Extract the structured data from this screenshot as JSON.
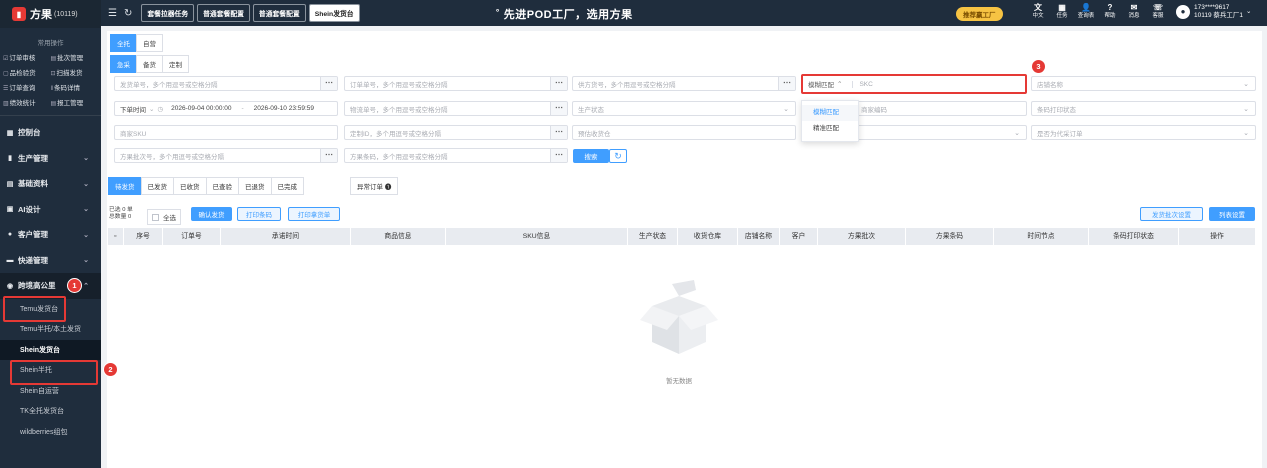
{
  "app": {
    "name": "方果",
    "account_id": "(10119)"
  },
  "sidebar": {
    "quick_title": "常用操作",
    "quick_ops": [
      {
        "icon": "check-icon",
        "label": "订单审核"
      },
      {
        "icon": "batch-icon",
        "label": "批次管理"
      },
      {
        "icon": "inspect-icon",
        "label": "品检验货"
      },
      {
        "icon": "scan-icon",
        "label": "扫描发货"
      },
      {
        "icon": "order-query-icon",
        "label": "订单查询"
      },
      {
        "icon": "barcode-icon",
        "label": "条码详情"
      },
      {
        "icon": "stats-icon",
        "label": "绩效统计"
      },
      {
        "icon": "report-icon",
        "label": "报工管理"
      }
    ],
    "menu": [
      {
        "label": "控制台",
        "icon": "dashboard-icon"
      },
      {
        "label": "生产管理",
        "icon": "production-icon"
      },
      {
        "label": "基础资料",
        "icon": "database-icon"
      },
      {
        "label": "AI设计",
        "icon": "ai-icon"
      },
      {
        "label": "客户管理",
        "icon": "customer-icon"
      },
      {
        "label": "快递管理",
        "icon": "express-icon"
      },
      {
        "label": "跨境高公里",
        "icon": "crossborder-icon"
      }
    ],
    "submenu": [
      "Temu发货台",
      "Temu半托/本土发货",
      "Shein发货台",
      "Shein半托",
      "Shein自运营",
      "TK全托发货台",
      "wildberries组包"
    ]
  },
  "topbar": {
    "tabs": [
      "套餐拉器任务",
      "普通套餐配置",
      "普通套餐配置",
      "Shein发货台"
    ],
    "slogan": "先进POD工厂，选用方果",
    "promo": "推荐赢工厂",
    "tools": [
      {
        "label": "中文",
        "icon": "translate-icon"
      },
      {
        "label": "任务",
        "icon": "task-icon"
      },
      {
        "label": "查询表",
        "icon": "query-icon"
      },
      {
        "label": "帮助",
        "icon": "help-icon"
      },
      {
        "label": "消息",
        "icon": "message-icon"
      },
      {
        "label": "客服",
        "icon": "service-icon"
      }
    ],
    "user": {
      "phone": "173****9617",
      "name": "10119 蔡兵工厂1"
    }
  },
  "filters": {
    "scope_tabs": [
      "全托",
      "自营"
    ],
    "type_tabs": [
      "急采",
      "备货",
      "定制"
    ],
    "placeholders": {
      "ship_no": "发货单号，多个用逗号或空格分隔",
      "order_no": "订单单号，多个用逗号或空格分隔",
      "supplier_no": "供方货号，多个用逗号或空格分隔",
      "skc": "SKC",
      "shop": "店铺名称",
      "logistics_no": "物流单号，多个用逗号或空格分隔",
      "prod_status": "生产状态",
      "merchant_code": "商家编码",
      "barcode_status": "条码打印状态",
      "merchant_sku": "商家SKU",
      "custom_id": "定制ID，多个用逗号或空格分隔",
      "warehouse": "预估收货仓",
      "proxy": "是否为代采订单",
      "batch_no": "方果批次号，多个用逗号或空格分隔",
      "fg_barcode": "方果条码，多个用逗号或空格分隔"
    },
    "match_mode": "模糊匹配",
    "match_options": [
      "模糊匹配",
      "精准匹配"
    ],
    "time_type": "下单时间",
    "date_start": "2026-09-04 00:00:00",
    "date_sep": "-",
    "date_end": "2026-09-10 23:59:59",
    "search_label": "搜索"
  },
  "status_tabs": [
    "待发货",
    "已发货",
    "已收货",
    "已查验",
    "已退货",
    "已完成"
  ],
  "abnormal_label": "异常订单",
  "counts": {
    "selected": "已选 0 单",
    "total": "总数量 0"
  },
  "actions": {
    "select_all": "全选",
    "confirm": "确认发货",
    "print_barcode": "打印条码",
    "print_pick": "打印拿货单",
    "batch_settings": "发货批次设置",
    "col_settings": "列表设置"
  },
  "table": {
    "columns": [
      "序号",
      "订单号",
      "承诺时间",
      "商品信息",
      "SKU信息",
      "生产状态",
      "收货仓库",
      "店铺名称",
      "客户",
      "方果批次",
      "方果条码",
      "时间节点",
      "条码打印状态",
      "操作"
    ],
    "empty_text": "暂无数据"
  },
  "annotations": [
    "1",
    "2",
    "3"
  ],
  "colors": {
    "primary": "#409eff",
    "sidebar": "#1f2d3d",
    "callout": "#e53935"
  }
}
